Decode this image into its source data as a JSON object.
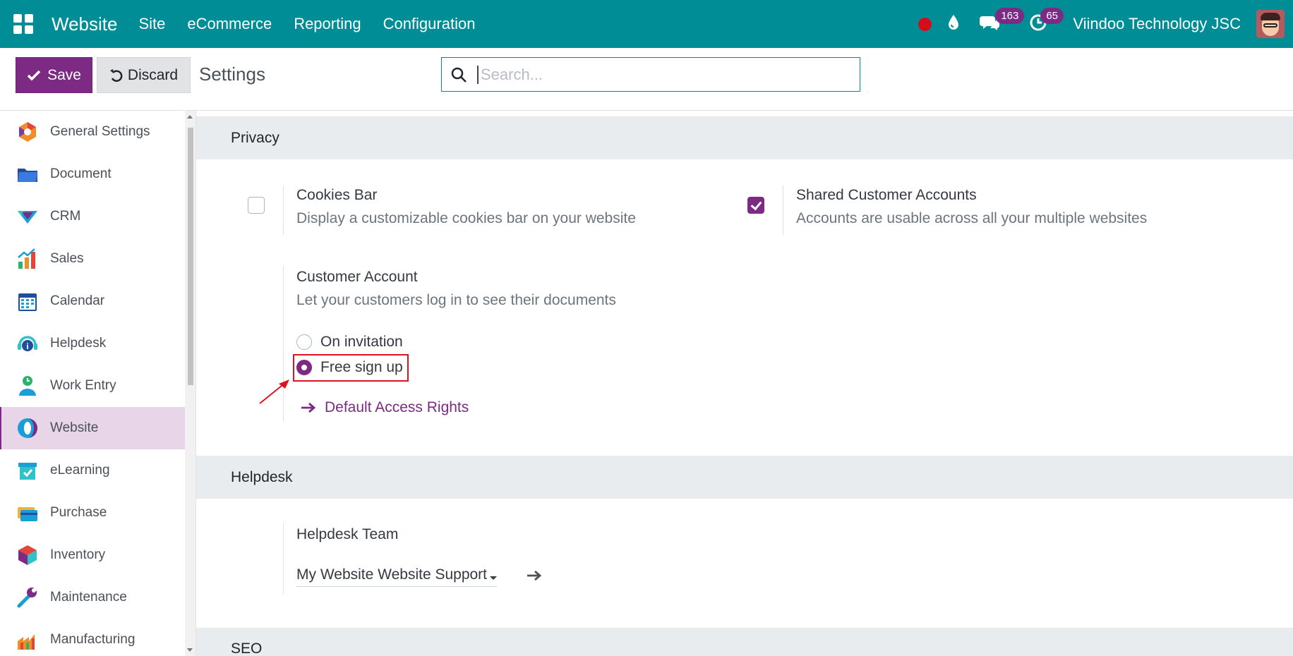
{
  "topbar": {
    "brand": "Website",
    "menu": [
      "Site",
      "eCommerce",
      "Reporting",
      "Configuration"
    ],
    "messages_count": "163",
    "activities_count": "65",
    "company": "Viindoo Technology JSC",
    "color": "#018d95"
  },
  "control": {
    "save_label": "Save",
    "discard_label": "Discard",
    "title": "Settings",
    "search_placeholder": "Search..."
  },
  "sidebar": {
    "items": [
      {
        "label": "General Settings",
        "icon": "general-settings-icon"
      },
      {
        "label": "Document",
        "icon": "document-icon"
      },
      {
        "label": "CRM",
        "icon": "crm-icon"
      },
      {
        "label": "Sales",
        "icon": "sales-icon"
      },
      {
        "label": "Calendar",
        "icon": "calendar-icon"
      },
      {
        "label": "Helpdesk",
        "icon": "helpdesk-icon"
      },
      {
        "label": "Work Entry",
        "icon": "work-entry-icon"
      },
      {
        "label": "Website",
        "icon": "website-icon",
        "active": true
      },
      {
        "label": "eLearning",
        "icon": "elearning-icon"
      },
      {
        "label": "Purchase",
        "icon": "purchase-icon"
      },
      {
        "label": "Inventory",
        "icon": "inventory-icon"
      },
      {
        "label": "Maintenance",
        "icon": "maintenance-icon"
      },
      {
        "label": "Manufacturing",
        "icon": "manufacturing-icon"
      }
    ]
  },
  "privacy": {
    "heading": "Privacy",
    "cookies": {
      "label": "Cookies Bar",
      "desc": "Display a customizable cookies bar on your website",
      "checked": false
    },
    "shared": {
      "label": "Shared Customer Accounts",
      "desc": "Accounts are usable across all your multiple websites",
      "checked": true
    },
    "customer_account": {
      "label": "Customer Account",
      "desc": "Let your customers log in to see their documents",
      "options": [
        "On invitation",
        "Free sign up"
      ],
      "selected": "Free sign up",
      "link": "Default Access Rights"
    }
  },
  "helpdesk": {
    "heading": "Helpdesk",
    "team_label": "Helpdesk Team",
    "team_value": "My Website Website Support"
  },
  "seo": {
    "heading": "SEO"
  },
  "colors": {
    "accent": "#7c2a83",
    "annotation": "#e0121f"
  }
}
